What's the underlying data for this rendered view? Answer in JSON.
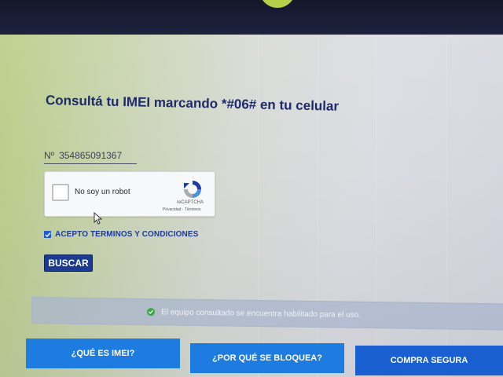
{
  "page": {
    "title": "Consultá tu IMEI marcando *#06# en tu celular"
  },
  "imei_field": {
    "prefix": "Nº",
    "value": "354865091367"
  },
  "recaptcha": {
    "label": "No soy un robot",
    "brand": "reCAPTCHA",
    "links": "Privacidad - Términos"
  },
  "terms": {
    "label": "ACEPTO TERMINOS Y CONDICIONES",
    "checked": true
  },
  "search": {
    "label": "BUSCAR"
  },
  "status": {
    "text": "El equipo consultado se encuentra habilitado para el uso.",
    "color": "#3aa84a"
  },
  "bottom_nav": {
    "imei_label": "¿QUÉ ES IMEI?",
    "bloqueo_label": "¿POR QUÉ SE BLOQUEA?",
    "compra_label": "COMPRA SEGURA"
  },
  "colors": {
    "title": "#1e2a6b",
    "button": "#1a3b8f",
    "nav_button": "#1e7be0",
    "header": "#1d2238",
    "logo_accent": "#b7cf48"
  }
}
